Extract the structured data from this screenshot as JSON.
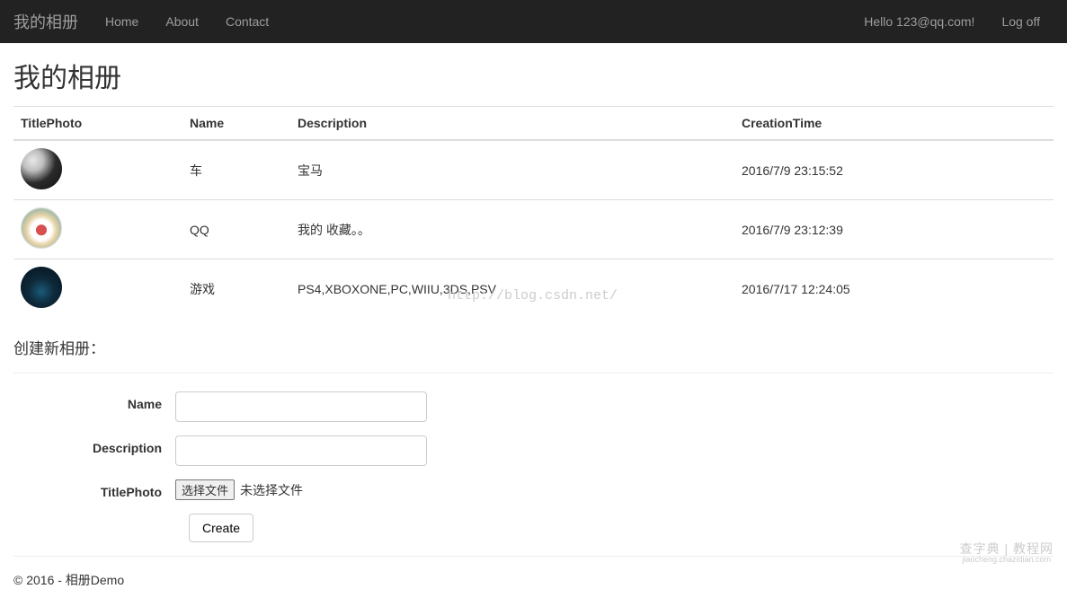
{
  "navbar": {
    "brand": "我的相册",
    "links": {
      "home": "Home",
      "about": "About",
      "contact": "Contact"
    },
    "greeting": "Hello 123@qq.com!",
    "logoff": "Log off"
  },
  "page": {
    "title": "我的相册",
    "create_heading": "创建新相册："
  },
  "table": {
    "headers": {
      "title_photo": "TitlePhoto",
      "name": "Name",
      "description": "Description",
      "creation_time": "CreationTime"
    },
    "rows": [
      {
        "name": "车",
        "description": "宝马",
        "creation_time": "2016/7/9 23:15:52"
      },
      {
        "name": "QQ",
        "description": "我的 收藏。。",
        "creation_time": "2016/7/9 23:12:39"
      },
      {
        "name": "游戏",
        "description": "PS4,XBOXONE,PC,WIIU,3DS,PSV",
        "creation_time": "2016/7/17 12:24:05"
      }
    ]
  },
  "form": {
    "labels": {
      "name": "Name",
      "description": "Description",
      "title_photo": "TitlePhoto"
    },
    "file_button": "选择文件",
    "file_status": "未选择文件",
    "submit": "Create"
  },
  "watermark": {
    "blog_url": "http://blog.csdn.net/",
    "site_line1": "查字典 | 教程网",
    "site_line2": "jiaocheng.chazidian.com"
  },
  "footer": {
    "text": "© 2016 - 相册Demo"
  }
}
